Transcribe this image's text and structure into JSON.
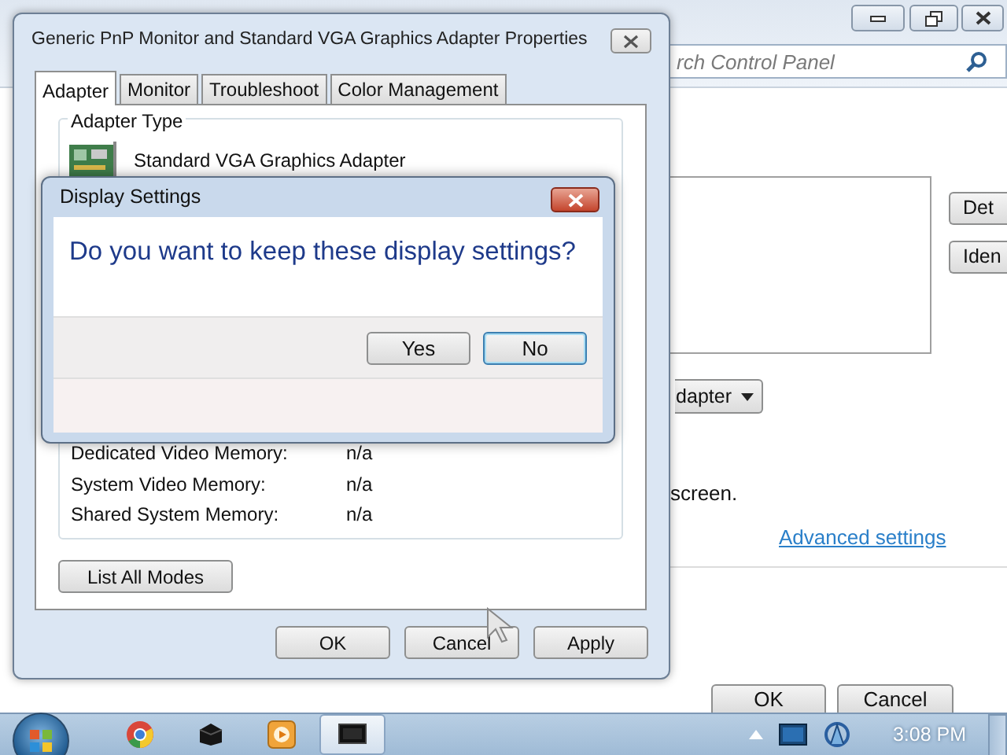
{
  "control_panel": {
    "caption_buttons": [
      {
        "kind": "minimize"
      },
      {
        "kind": "restore"
      },
      {
        "kind": "close"
      }
    ],
    "search": {
      "placeholder": "rch Control Panel"
    },
    "side_buttons": [
      "Det",
      "Iden"
    ],
    "dropdown": {
      "value": "dapter"
    },
    "note": "screen.",
    "link": "Advanced settings",
    "buttons": [
      "OK",
      "Cancel"
    ]
  },
  "properties_dialog": {
    "title": "Generic PnP Monitor and Standard VGA Graphics Adapter Properties",
    "tabs": [
      {
        "label": "Adapter",
        "selected": true
      },
      {
        "label": "Monitor",
        "selected": false
      },
      {
        "label": "Troubleshoot",
        "selected": false
      },
      {
        "label": "Color Management",
        "selected": false
      }
    ],
    "adapter_type": {
      "heading": "Adapter Type",
      "name": "Standard VGA Graphics Adapter"
    },
    "memory": [
      {
        "label": "Dedicated Video Memory:",
        "value": "n/a"
      },
      {
        "label": "System Video Memory:",
        "value": "n/a"
      },
      {
        "label": "Shared System Memory:",
        "value": "n/a"
      }
    ],
    "list_modes_button": "List All Modes",
    "buttons": [
      "OK",
      "Cancel",
      "Apply"
    ]
  },
  "display_settings_dialog": {
    "title": "Display Settings",
    "question": "Do you want to keep these display settings?",
    "buttons": [
      {
        "label": "Yes",
        "focused": false
      },
      {
        "label": "No",
        "focused": true
      }
    ]
  },
  "taskbar": {
    "apps": [
      {
        "kind": "chrome",
        "active": false
      },
      {
        "kind": "box",
        "active": false
      },
      {
        "kind": "media",
        "active": false
      },
      {
        "kind": "window",
        "active": true
      }
    ],
    "tray": [
      {
        "kind": "arrow"
      },
      {
        "kind": "monitor"
      },
      {
        "kind": "network"
      }
    ],
    "clock": "3:08 PM"
  }
}
